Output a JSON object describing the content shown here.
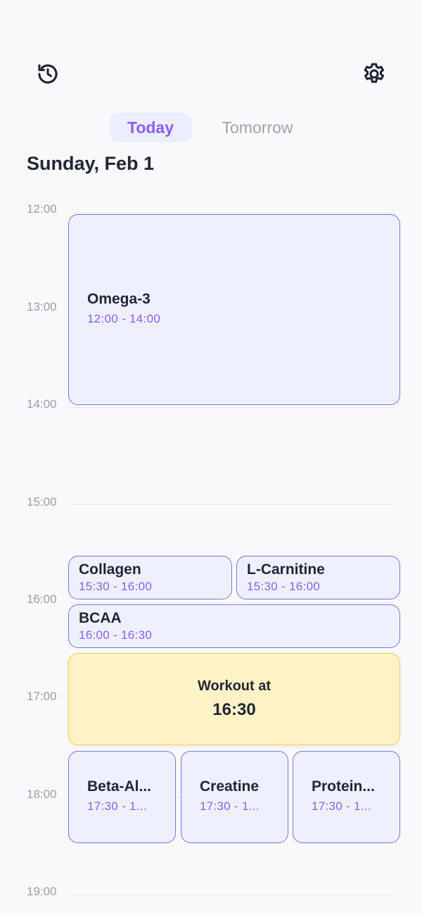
{
  "header": {
    "history_icon": "history-icon",
    "settings_icon": "gear-icon"
  },
  "tabs": [
    {
      "label": "Today",
      "selected": true
    },
    {
      "label": "Tomorrow",
      "selected": false
    }
  ],
  "date_title": "Sunday, Feb 1",
  "hours": [
    "12:00",
    "13:00",
    "14:00",
    "15:00",
    "16:00",
    "17:00",
    "18:00",
    "19:00"
  ],
  "events": [
    {
      "name": "Omega-3",
      "time": "12:00 - 14:00"
    },
    {
      "name": "Collagen",
      "time": "15:30 - 16:00"
    },
    {
      "name": "L-Carnitine",
      "time": "15:30 - 16:00"
    },
    {
      "name": "BCAA",
      "time": "16:00 - 16:30"
    },
    {
      "name": "Beta-Al...",
      "time": "17:30 - 1..."
    },
    {
      "name": "Creatine",
      "time": "17:30 - 1..."
    },
    {
      "name": "Protein...",
      "time": "17:30 - 1..."
    }
  ],
  "workout": {
    "label": "Workout at",
    "time": "16:30"
  },
  "colors": {
    "accent": "#8b5cf6",
    "event_bg": "#eef1fd",
    "event_border": "#7b72dd",
    "workout_bg": "#fef2c6",
    "workout_border": "#f2cf5b"
  }
}
